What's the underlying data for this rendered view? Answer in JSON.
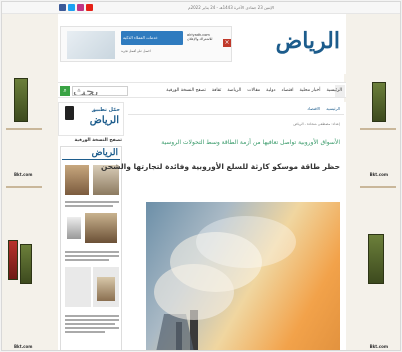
{
  "topbar": {
    "date": "الإثنين 23 جمادى الآخرة 1443هـ - 24 يناير 2022م",
    "social": [
      "facebook",
      "twitter",
      "instagram",
      "youtube"
    ],
    "colors": {
      "facebook": "#3b5998",
      "twitter": "#1da1f2",
      "instagram": "#c13584",
      "youtube": "#e62117"
    }
  },
  "masthead": {
    "logo": "الرياض",
    "ad": {
      "banner": "خدمات العملاء الذكية",
      "sub": "احصل على أفضل تجربة",
      "right_line1": "alriyadh.com",
      "right_line2": "للاشتراك والإعلان",
      "close": "×"
    }
  },
  "nav": {
    "items": [
      "الرئيسية",
      "أخبار محلية",
      "اقتصاد",
      "دولية",
      "مقالات",
      "الرياضة",
      "ثقافة",
      "تصفح النسخة الورقية"
    ],
    "search_placeholder": "بحث"
  },
  "leftcol": {
    "app_ad_text": "حمّل تطبيق",
    "app_ad_brand": "الرياض",
    "epaper_title": "تصفح النسخة الورقية",
    "epaper_logo": "الرياض"
  },
  "rails": {
    "shop_label": "Bkt.com"
  },
  "article": {
    "crumbs": [
      "الرئيسية",
      "الاقتصاد"
    ],
    "byline": "إعداد: مصطفى شحادة - الرياض",
    "subhead": "الأسواق الأوروبية تواصل تعافيها من أزمة الطاقة وسط التحولات الروسية",
    "headline": "حظر طاقة موسكو كارثة للسلع الأوروبية وفائدة لتجارتها والشحن"
  },
  "colors": {
    "brand": "#1c5c8c",
    "accent_green": "#3a9b6b",
    "search_green": "#3aa345"
  }
}
